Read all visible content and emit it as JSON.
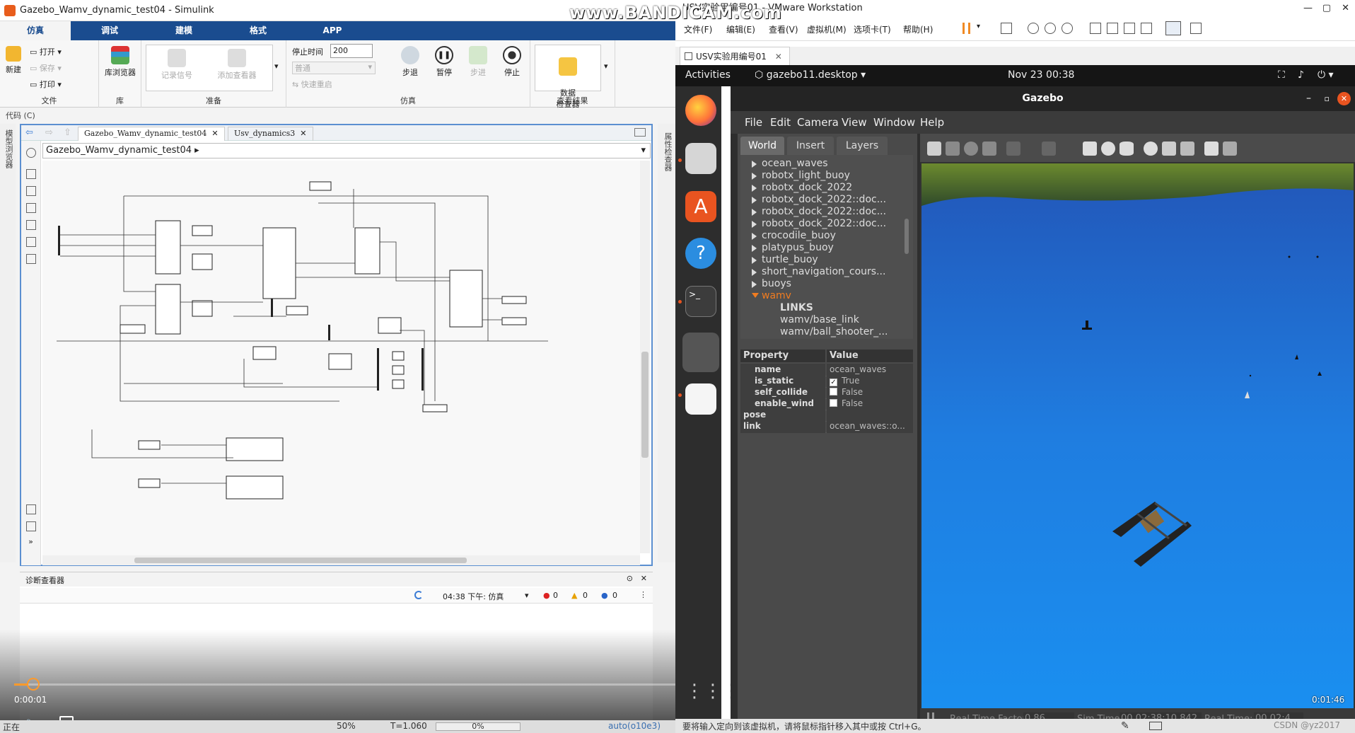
{
  "watermark": "www.BANDICAM.com",
  "simulink": {
    "window_title": "Gazebo_Wamv_dynamic_test04 - Simulink",
    "tabs": [
      "仿真",
      "调试",
      "建模",
      "格式",
      "APP"
    ],
    "file_section": {
      "new": "新建",
      "open": "打开",
      "save": "保存",
      "print": "打印",
      "label": "文件"
    },
    "library_section": {
      "browser": "库浏览器",
      "label": "库"
    },
    "prepare_section": {
      "record": "记录信号",
      "add_viewer": "添加查看器",
      "label": "准备"
    },
    "sim_section": {
      "stop_time_label": "停止时间",
      "stop_time_value": "200",
      "mode": "普通",
      "fast_restart": "快速重启",
      "step_back": "步退",
      "pause": "暂停",
      "step_forward": "步进",
      "stop": "停止",
      "label": "仿真"
    },
    "results_section": {
      "inspector": "数据\n检查器",
      "label": "查看结果"
    },
    "code_label": "代码 (C)",
    "left_panel_label": "模型浏览器",
    "right_panel_label": "属性检查器",
    "editor_tabs": [
      "Gazebo_Wamv_dynamic_test04",
      "Usv_dynamics3"
    ],
    "breadcrumb": "Gazebo_Wamv_dynamic_test04",
    "diagnostics": {
      "title": "诊断查看器",
      "time": "04:38 下午: 仿真",
      "errors": "0",
      "warnings": "0",
      "infos": "0"
    },
    "video": {
      "elapsed": "0:00:01",
      "progress": 0.02
    },
    "status": {
      "left": "正在",
      "zoom": "50%",
      "time": "T=1.060",
      "percent": "0%",
      "solver": "auto(o10e3)"
    }
  },
  "vmware": {
    "window_title": "USV实验用编号01 - VMware Workstation",
    "menu": [
      "文件(F)",
      "编辑(E)",
      "查看(V)",
      "虚拟机(M)",
      "选项卡(T)",
      "帮助(H)"
    ],
    "vm_tab": "USV实验用编号01",
    "status_text": "要将输入定向到该虚拟机，请将鼠标指针移入其中或按 Ctrl+G。",
    "status_right": "CSDN @yz2017"
  },
  "ubuntu": {
    "activities": "Activities",
    "app_menu": "gazebo11.desktop",
    "clock": "Nov 23  00:38"
  },
  "gazebo": {
    "title": "Gazebo",
    "menu": [
      "File",
      "Edit",
      "Camera",
      "View",
      "Window",
      "Help"
    ],
    "left_tabs": [
      "World",
      "Insert",
      "Layers"
    ],
    "tree": [
      {
        "label": "ocean_waves",
        "arrow": true
      },
      {
        "label": "robotx_light_buoy",
        "arrow": true
      },
      {
        "label": "robotx_dock_2022",
        "arrow": true
      },
      {
        "label": "robotx_dock_2022::doc...",
        "arrow": true
      },
      {
        "label": "robotx_dock_2022::doc...",
        "arrow": true
      },
      {
        "label": "robotx_dock_2022::doc...",
        "arrow": true
      },
      {
        "label": "crocodile_buoy",
        "arrow": true
      },
      {
        "label": "platypus_buoy",
        "arrow": true
      },
      {
        "label": "turtle_buoy",
        "arrow": true
      },
      {
        "label": "short_navigation_cours...",
        "arrow": true
      },
      {
        "label": "buoys",
        "arrow": true
      },
      {
        "label": "wamv",
        "arrow": true,
        "selected": true
      },
      {
        "label": "LINKS",
        "arrow": false
      },
      {
        "label": "wamv/base_link",
        "arrow": false
      },
      {
        "label": "wamv/ball_shooter_...",
        "arrow": false
      }
    ],
    "property_header": {
      "key": "Property",
      "value": "Value"
    },
    "properties": [
      {
        "key": "name",
        "value": "ocean_waves"
      },
      {
        "key": "is_static",
        "value": "True",
        "checked": true
      },
      {
        "key": "self_collide",
        "value": "False",
        "checked": false
      },
      {
        "key": "enable_wind",
        "value": "False",
        "checked": false
      },
      {
        "key": "pose",
        "value": ""
      },
      {
        "key": "link",
        "value": "ocean_waves::o..."
      }
    ],
    "bottom": {
      "rtf_label": "Real Time Factor:",
      "rtf": "0.86",
      "sim_label": "Sim Time:",
      "sim": "00 02:38:10.842",
      "real_label": "Real Time:",
      "real": "00 02:4"
    },
    "video_time": "0:01:46"
  }
}
